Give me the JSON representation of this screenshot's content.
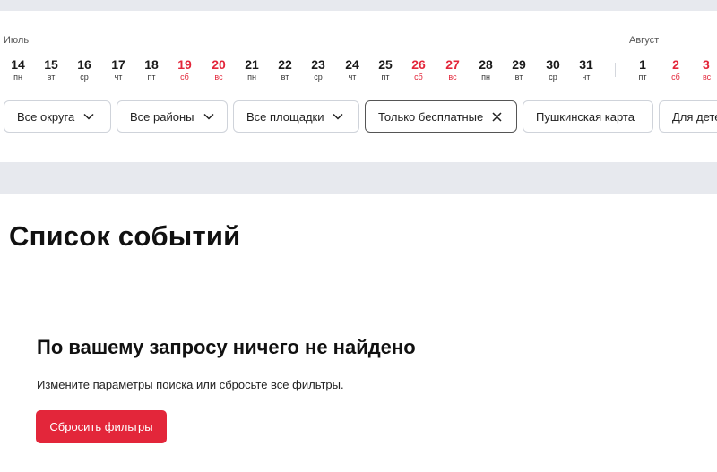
{
  "calendar": {
    "months": [
      {
        "label": "Июль"
      },
      {
        "label": "Август"
      }
    ],
    "days": [
      {
        "num": "14",
        "wd": "пн",
        "weekend": false
      },
      {
        "num": "15",
        "wd": "вт",
        "weekend": false
      },
      {
        "num": "16",
        "wd": "ср",
        "weekend": false
      },
      {
        "num": "17",
        "wd": "чт",
        "weekend": false
      },
      {
        "num": "18",
        "wd": "пт",
        "weekend": false
      },
      {
        "num": "19",
        "wd": "сб",
        "weekend": true
      },
      {
        "num": "20",
        "wd": "вс",
        "weekend": true
      },
      {
        "num": "21",
        "wd": "пн",
        "weekend": false
      },
      {
        "num": "22",
        "wd": "вт",
        "weekend": false
      },
      {
        "num": "23",
        "wd": "ср",
        "weekend": false
      },
      {
        "num": "24",
        "wd": "чт",
        "weekend": false
      },
      {
        "num": "25",
        "wd": "пт",
        "weekend": false
      },
      {
        "num": "26",
        "wd": "сб",
        "weekend": true
      },
      {
        "num": "27",
        "wd": "вс",
        "weekend": true
      },
      {
        "num": "28",
        "wd": "пн",
        "weekend": false
      },
      {
        "num": "29",
        "wd": "вт",
        "weekend": false
      },
      {
        "num": "30",
        "wd": "ср",
        "weekend": false
      },
      {
        "num": "31",
        "wd": "чт",
        "weekend": false
      },
      {
        "num": "1",
        "wd": "пт",
        "weekend": false
      },
      {
        "num": "2",
        "wd": "сб",
        "weekend": true
      },
      {
        "num": "3",
        "wd": "вс",
        "weekend": true
      }
    ]
  },
  "filters": [
    {
      "label": "Все округа",
      "icon": "chevron-down-icon",
      "active": false
    },
    {
      "label": "Все районы",
      "icon": "chevron-down-icon",
      "active": false
    },
    {
      "label": "Все площадки",
      "icon": "chevron-down-icon",
      "active": false
    },
    {
      "label": "Только бесплатные",
      "icon": "close-icon",
      "active": true
    },
    {
      "label": "Пушкинская карта",
      "icon": "",
      "active": false
    },
    {
      "label": "Для детей",
      "icon": "",
      "active": false
    }
  ],
  "main": {
    "title": "Список событий",
    "empty_title": "По вашему запросу ничего не найдено",
    "empty_text": "Измените параметры поиска или сбросьте все фильтры.",
    "reset_label": "Сбросить фильтры"
  },
  "colors": {
    "accent": "#e3263a",
    "band": "#e7e9ee"
  }
}
